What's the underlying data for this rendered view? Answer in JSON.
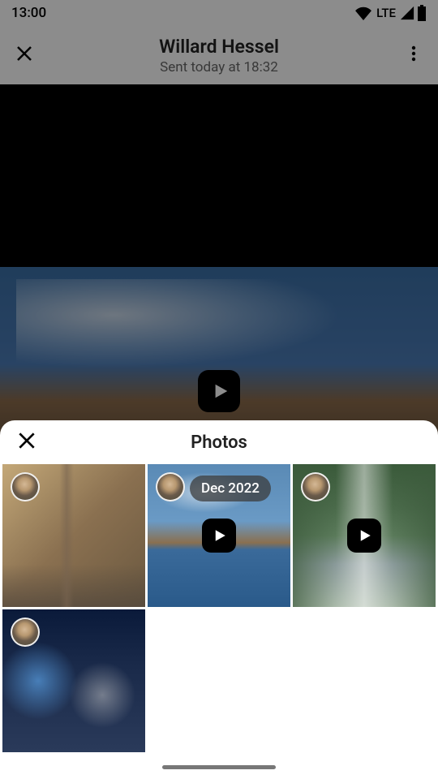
{
  "status": {
    "time": "13:00",
    "network": "LTE"
  },
  "header": {
    "title": "Willard Hessel",
    "subtitle": "Sent today at 18:32"
  },
  "sheet": {
    "title": "Photos"
  },
  "grid": {
    "items": [
      {
        "type": "photo",
        "date": null
      },
      {
        "type": "video",
        "date": "Dec 2022"
      },
      {
        "type": "video",
        "date": null
      },
      {
        "type": "photo",
        "date": null
      }
    ]
  }
}
